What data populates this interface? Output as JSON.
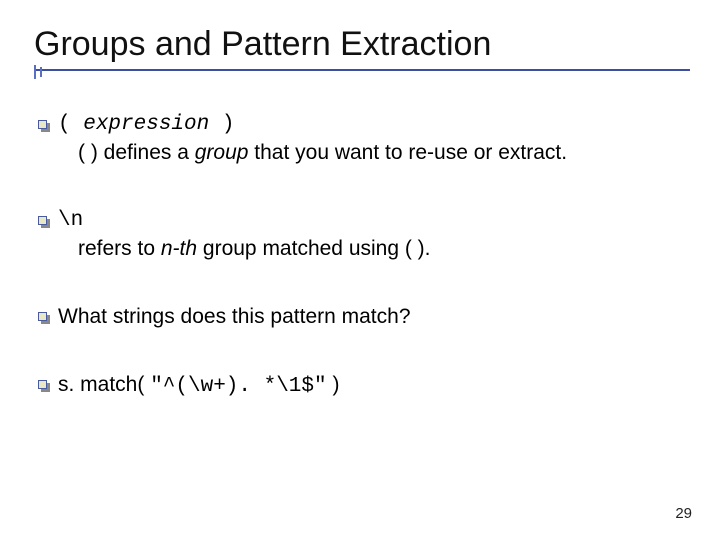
{
  "title": "Groups and Pattern Extraction",
  "sig1_open": "( ",
  "sig1_expr": "expression",
  "sig1_close": " )",
  "body1_pre": "(  ) defines a ",
  "body1_it": "group",
  "body1_post": " that you want to re-use or extract.",
  "sig2": "\\n",
  "body2_pre": "refers to ",
  "body2_it": "n-th",
  "body2_post": " group matched using ( ).",
  "q": "What strings does this pattern match?",
  "match_pre": "s. match( ",
  "match_code": "\"^(\\w+). *\\1$\"",
  "match_post": " )",
  "slidenum": "29"
}
